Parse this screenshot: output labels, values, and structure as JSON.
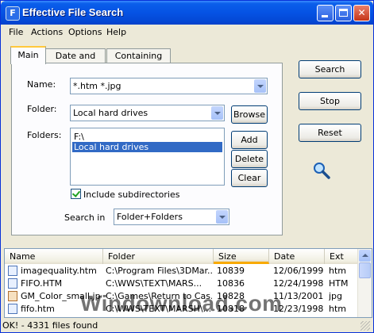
{
  "window": {
    "title": "Effective File Search",
    "app_icon_glyph": "F",
    "minimize_icon": "minimize-icon",
    "maximize_icon": "maximize-icon",
    "close_glyph": "✕"
  },
  "menu": [
    "File",
    "Actions",
    "Options",
    "Help"
  ],
  "tabs": [
    "Main",
    "Date and size",
    "Containing text"
  ],
  "form": {
    "name_label": "Name:",
    "name_value": "*.htm *.jpg",
    "folder_label": "Folder:",
    "folder_value": "Local hard drives",
    "browse_label": "Browse",
    "folders_label": "Folders:",
    "folders_list": [
      "F:\\",
      "Local hard drives"
    ],
    "add_label": "Add",
    "delete_label": "Delete",
    "clear_label": "Clear",
    "include_subdirs_label": "Include subdirectories",
    "include_subdirs_checked": true,
    "search_in_label": "Search in",
    "search_in_value": "Folder+Folders"
  },
  "actions": {
    "search_label": "Search",
    "stop_label": "Stop",
    "reset_label": "Reset"
  },
  "results": {
    "columns": [
      "Name",
      "Folder",
      "Size",
      "Date",
      "Ext"
    ],
    "rows": [
      {
        "name": "imagequality.htm",
        "folder": "C:\\Program Files\\3DMar...",
        "size": "10839",
        "date": "12/06/1999",
        "ext": "htm"
      },
      {
        "name": "FIFO.HTM",
        "folder": "C:\\WWS\\TEXT\\MARS...",
        "size": "10836",
        "date": "12/24/1998",
        "ext": "HTM"
      },
      {
        "name": "GM_Color_small.jpg",
        "folder": "C:\\Games\\Return to Cas...",
        "size": "10828",
        "date": "11/13/2001",
        "ext": "jpg"
      },
      {
        "name": "fifo.htm",
        "folder": "C:\\WWS\\TEXT\\MARSH\\...",
        "size": "10818",
        "date": "12/23/1998",
        "ext": "htm"
      }
    ]
  },
  "status": "OK! - 4331 files found",
  "watermark": "Windownload.com",
  "colors": {
    "titlebar": "#0553E4",
    "selection": "#316AC5",
    "window_bg": "#ECE9D8"
  }
}
